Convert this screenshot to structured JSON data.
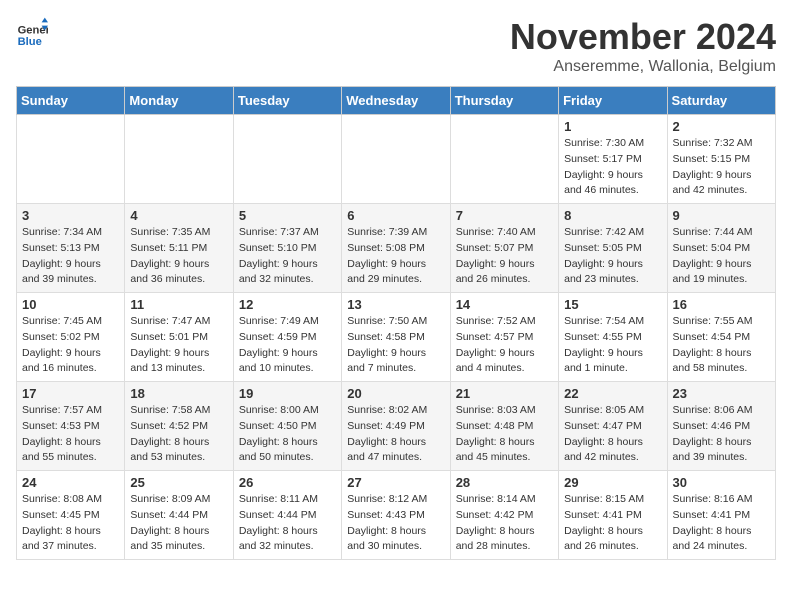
{
  "logo": {
    "text_general": "General",
    "text_blue": "Blue"
  },
  "title": {
    "month": "November 2024",
    "location": "Anseremme, Wallonia, Belgium"
  },
  "headers": [
    "Sunday",
    "Monday",
    "Tuesday",
    "Wednesday",
    "Thursday",
    "Friday",
    "Saturday"
  ],
  "weeks": [
    [
      {
        "day": "",
        "sunrise": "",
        "sunset": "",
        "daylight": "",
        "empty": true
      },
      {
        "day": "",
        "sunrise": "",
        "sunset": "",
        "daylight": "",
        "empty": true
      },
      {
        "day": "",
        "sunrise": "",
        "sunset": "",
        "daylight": "",
        "empty": true
      },
      {
        "day": "",
        "sunrise": "",
        "sunset": "",
        "daylight": "",
        "empty": true
      },
      {
        "day": "",
        "sunrise": "",
        "sunset": "",
        "daylight": "",
        "empty": true
      },
      {
        "day": "1",
        "sunrise": "Sunrise: 7:30 AM",
        "sunset": "Sunset: 5:17 PM",
        "daylight": "Daylight: 9 hours and 46 minutes.",
        "empty": false
      },
      {
        "day": "2",
        "sunrise": "Sunrise: 7:32 AM",
        "sunset": "Sunset: 5:15 PM",
        "daylight": "Daylight: 9 hours and 42 minutes.",
        "empty": false
      }
    ],
    [
      {
        "day": "3",
        "sunrise": "Sunrise: 7:34 AM",
        "sunset": "Sunset: 5:13 PM",
        "daylight": "Daylight: 9 hours and 39 minutes.",
        "empty": false
      },
      {
        "day": "4",
        "sunrise": "Sunrise: 7:35 AM",
        "sunset": "Sunset: 5:11 PM",
        "daylight": "Daylight: 9 hours and 36 minutes.",
        "empty": false
      },
      {
        "day": "5",
        "sunrise": "Sunrise: 7:37 AM",
        "sunset": "Sunset: 5:10 PM",
        "daylight": "Daylight: 9 hours and 32 minutes.",
        "empty": false
      },
      {
        "day": "6",
        "sunrise": "Sunrise: 7:39 AM",
        "sunset": "Sunset: 5:08 PM",
        "daylight": "Daylight: 9 hours and 29 minutes.",
        "empty": false
      },
      {
        "day": "7",
        "sunrise": "Sunrise: 7:40 AM",
        "sunset": "Sunset: 5:07 PM",
        "daylight": "Daylight: 9 hours and 26 minutes.",
        "empty": false
      },
      {
        "day": "8",
        "sunrise": "Sunrise: 7:42 AM",
        "sunset": "Sunset: 5:05 PM",
        "daylight": "Daylight: 9 hours and 23 minutes.",
        "empty": false
      },
      {
        "day": "9",
        "sunrise": "Sunrise: 7:44 AM",
        "sunset": "Sunset: 5:04 PM",
        "daylight": "Daylight: 9 hours and 19 minutes.",
        "empty": false
      }
    ],
    [
      {
        "day": "10",
        "sunrise": "Sunrise: 7:45 AM",
        "sunset": "Sunset: 5:02 PM",
        "daylight": "Daylight: 9 hours and 16 minutes.",
        "empty": false
      },
      {
        "day": "11",
        "sunrise": "Sunrise: 7:47 AM",
        "sunset": "Sunset: 5:01 PM",
        "daylight": "Daylight: 9 hours and 13 minutes.",
        "empty": false
      },
      {
        "day": "12",
        "sunrise": "Sunrise: 7:49 AM",
        "sunset": "Sunset: 4:59 PM",
        "daylight": "Daylight: 9 hours and 10 minutes.",
        "empty": false
      },
      {
        "day": "13",
        "sunrise": "Sunrise: 7:50 AM",
        "sunset": "Sunset: 4:58 PM",
        "daylight": "Daylight: 9 hours and 7 minutes.",
        "empty": false
      },
      {
        "day": "14",
        "sunrise": "Sunrise: 7:52 AM",
        "sunset": "Sunset: 4:57 PM",
        "daylight": "Daylight: 9 hours and 4 minutes.",
        "empty": false
      },
      {
        "day": "15",
        "sunrise": "Sunrise: 7:54 AM",
        "sunset": "Sunset: 4:55 PM",
        "daylight": "Daylight: 9 hours and 1 minute.",
        "empty": false
      },
      {
        "day": "16",
        "sunrise": "Sunrise: 7:55 AM",
        "sunset": "Sunset: 4:54 PM",
        "daylight": "Daylight: 8 hours and 58 minutes.",
        "empty": false
      }
    ],
    [
      {
        "day": "17",
        "sunrise": "Sunrise: 7:57 AM",
        "sunset": "Sunset: 4:53 PM",
        "daylight": "Daylight: 8 hours and 55 minutes.",
        "empty": false
      },
      {
        "day": "18",
        "sunrise": "Sunrise: 7:58 AM",
        "sunset": "Sunset: 4:52 PM",
        "daylight": "Daylight: 8 hours and 53 minutes.",
        "empty": false
      },
      {
        "day": "19",
        "sunrise": "Sunrise: 8:00 AM",
        "sunset": "Sunset: 4:50 PM",
        "daylight": "Daylight: 8 hours and 50 minutes.",
        "empty": false
      },
      {
        "day": "20",
        "sunrise": "Sunrise: 8:02 AM",
        "sunset": "Sunset: 4:49 PM",
        "daylight": "Daylight: 8 hours and 47 minutes.",
        "empty": false
      },
      {
        "day": "21",
        "sunrise": "Sunrise: 8:03 AM",
        "sunset": "Sunset: 4:48 PM",
        "daylight": "Daylight: 8 hours and 45 minutes.",
        "empty": false
      },
      {
        "day": "22",
        "sunrise": "Sunrise: 8:05 AM",
        "sunset": "Sunset: 4:47 PM",
        "daylight": "Daylight: 8 hours and 42 minutes.",
        "empty": false
      },
      {
        "day": "23",
        "sunrise": "Sunrise: 8:06 AM",
        "sunset": "Sunset: 4:46 PM",
        "daylight": "Daylight: 8 hours and 39 minutes.",
        "empty": false
      }
    ],
    [
      {
        "day": "24",
        "sunrise": "Sunrise: 8:08 AM",
        "sunset": "Sunset: 4:45 PM",
        "daylight": "Daylight: 8 hours and 37 minutes.",
        "empty": false
      },
      {
        "day": "25",
        "sunrise": "Sunrise: 8:09 AM",
        "sunset": "Sunset: 4:44 PM",
        "daylight": "Daylight: 8 hours and 35 minutes.",
        "empty": false
      },
      {
        "day": "26",
        "sunrise": "Sunrise: 8:11 AM",
        "sunset": "Sunset: 4:44 PM",
        "daylight": "Daylight: 8 hours and 32 minutes.",
        "empty": false
      },
      {
        "day": "27",
        "sunrise": "Sunrise: 8:12 AM",
        "sunset": "Sunset: 4:43 PM",
        "daylight": "Daylight: 8 hours and 30 minutes.",
        "empty": false
      },
      {
        "day": "28",
        "sunrise": "Sunrise: 8:14 AM",
        "sunset": "Sunset: 4:42 PM",
        "daylight": "Daylight: 8 hours and 28 minutes.",
        "empty": false
      },
      {
        "day": "29",
        "sunrise": "Sunrise: 8:15 AM",
        "sunset": "Sunset: 4:41 PM",
        "daylight": "Daylight: 8 hours and 26 minutes.",
        "empty": false
      },
      {
        "day": "30",
        "sunrise": "Sunrise: 8:16 AM",
        "sunset": "Sunset: 4:41 PM",
        "daylight": "Daylight: 8 hours and 24 minutes.",
        "empty": false
      }
    ]
  ]
}
